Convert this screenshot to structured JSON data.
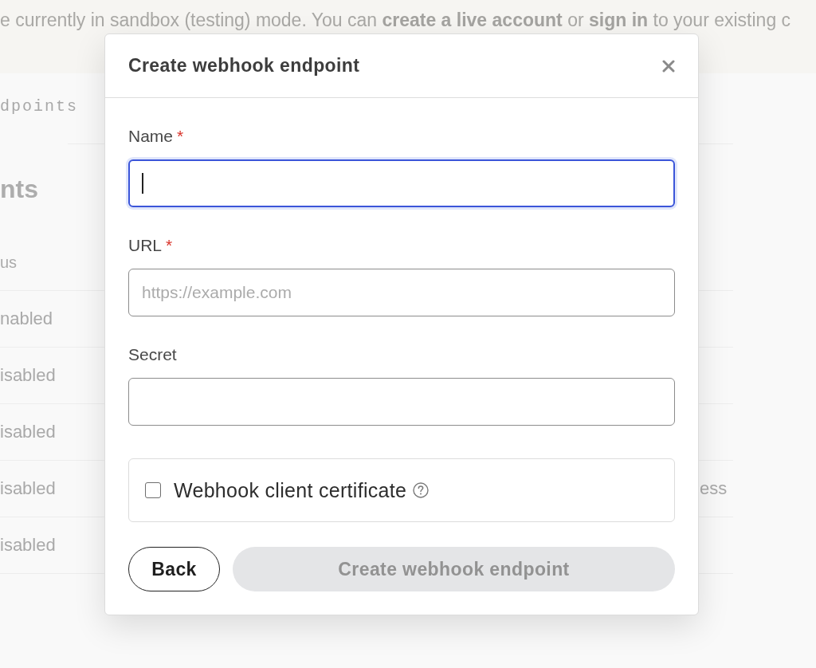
{
  "background_page": {
    "notice": [
      {
        "kind": "text",
        "text": "e currently in sandbox (testing) mode. You can "
      },
      {
        "kind": "link",
        "text": "create a live account"
      },
      {
        "kind": "text",
        "text": " or "
      },
      {
        "kind": "link",
        "text": "sign in"
      },
      {
        "kind": "text",
        "text": " to your existing c"
      }
    ],
    "breadcrumb": "dpoints",
    "heading": "nts",
    "table": {
      "columns": [
        "us"
      ],
      "rows": [
        {
          "column_1": "nabled"
        },
        {
          "column_1": "isabled"
        },
        {
          "column_1": "isabled"
        },
        {
          "column_1": "isabled",
          "column_2": "ess"
        },
        {
          "column_1": "isabled"
        }
      ]
    }
  },
  "dialog": {
    "title": "Create webhook endpoint",
    "fields": [
      {
        "label": "Name",
        "required_marker": "*",
        "focused": true
      },
      {
        "label": "URL",
        "required_marker": "*",
        "placeholder": "https://example.com",
        "focused": false
      },
      {
        "label": "Secret",
        "focused": false
      }
    ],
    "checkbox": {
      "label": "Webhook client certificate",
      "checked": false
    },
    "buttons": [
      {
        "label": "Back",
        "kind": "secondary",
        "disabled": false
      },
      {
        "label": "Create webhook endpoint",
        "kind": "primary",
        "disabled": true
      }
    ]
  }
}
